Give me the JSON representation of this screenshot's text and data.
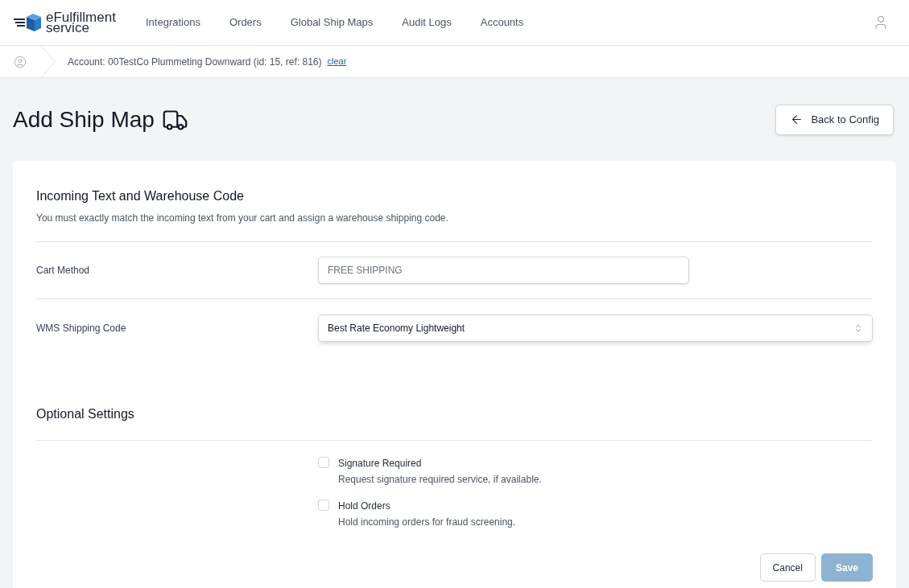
{
  "logo": {
    "line_1": "eFulfillment",
    "line_2": "service"
  },
  "nav": [
    {
      "label": "Integrations",
      "selected": false
    },
    {
      "label": "Orders",
      "selected": false
    },
    {
      "label": "Global Ship Maps",
      "selected": false
    },
    {
      "label": "Audit Logs",
      "selected": false
    },
    {
      "label": "Accounts",
      "selected": false
    }
  ],
  "breadcrumb": {
    "account": "Account: 00TestCo Plummeting Downward (id: 15, ref: 816)",
    "clear_link": "clear"
  },
  "page": {
    "title": "Add Ship Map",
    "back_button": "Back to Config"
  },
  "section_1": {
    "title": "Incoming Text and Warehouse Code",
    "description": "You must exactly match the incoming text from your cart and assign a warehouse shipping code."
  },
  "fields": [
    {
      "kind": "text",
      "label": "Cart Method",
      "placeholder": "FREE SHIPPING"
    },
    {
      "kind": "select",
      "label": "WMS Shipping Code",
      "value": "Best Rate Economy Lightweight"
    }
  ],
  "section_2": {
    "title": "Optional Settings"
  },
  "options": [
    {
      "label": "Signature Required",
      "description": "Request signature required service, if available.",
      "checked": false
    },
    {
      "label": "Hold Orders",
      "description": "Hold incoming orders for fraud screening.",
      "checked": false
    }
  ],
  "actions": {
    "cancel": "Cancel",
    "save": "Save",
    "save_disabled": true
  }
}
